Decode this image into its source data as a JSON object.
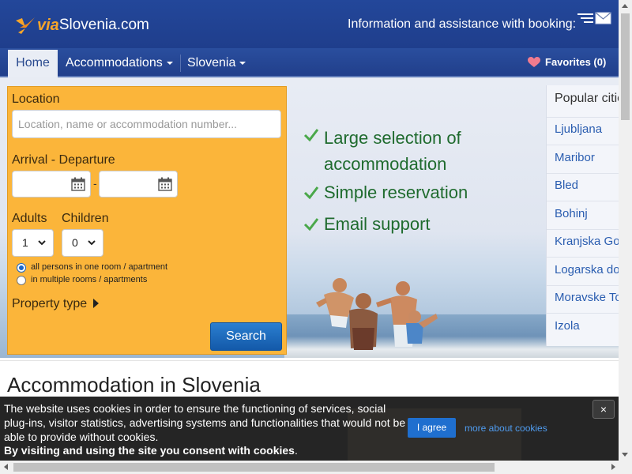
{
  "header": {
    "logo_via": "via",
    "logo_rest": "Slovenia.com",
    "help_text": "Information and assistance with booking:"
  },
  "nav": {
    "home": "Home",
    "accommodations": "Accommodations",
    "slovenia": "Slovenia",
    "favorites": "Favorites (0)"
  },
  "search": {
    "location_label": "Location",
    "location_placeholder": "Location, name or accommodation number...",
    "dates_label": "Arrival - Departure",
    "date_separator": "-",
    "adults_label": "Adults",
    "adults_value": "1",
    "children_label": "Children",
    "children_value": "0",
    "room_option_1": "all persons in one room / apartment",
    "room_option_2": "in multiple rooms / apartments",
    "property_type_label": "Property type",
    "search_button": "Search"
  },
  "features": {
    "f1_line1": "Large selection of",
    "f1_line2": "accommodation",
    "f2": "Simple reservation",
    "f3": "Email support"
  },
  "popular": {
    "title": "Popular cities",
    "cities": [
      "Ljubljana",
      "Maribor",
      "Bled",
      "Bohinj",
      "Kranjska Gora",
      "Logarska dolina",
      "Moravske Toplice",
      "Izola"
    ]
  },
  "main": {
    "section_title": "Accommodation in Slovenia"
  },
  "cookie": {
    "text": "The website uses cookies in order to ensure the functioning of services, social plug-ins, visitor statistics, advertising systems and functionalities that would not be able to provide without cookies.",
    "strong": "By visiting and using the site you consent with cookies",
    "strong_suffix": ".",
    "agree": "I agree",
    "more": "more about cookies",
    "close": "×"
  },
  "colors": {
    "header_blue": "#1f3e8c",
    "panel_orange": "#fbb53a",
    "feature_green": "#1f6b2e",
    "link_blue": "#2a5db0",
    "button_blue": "#1359a9"
  }
}
